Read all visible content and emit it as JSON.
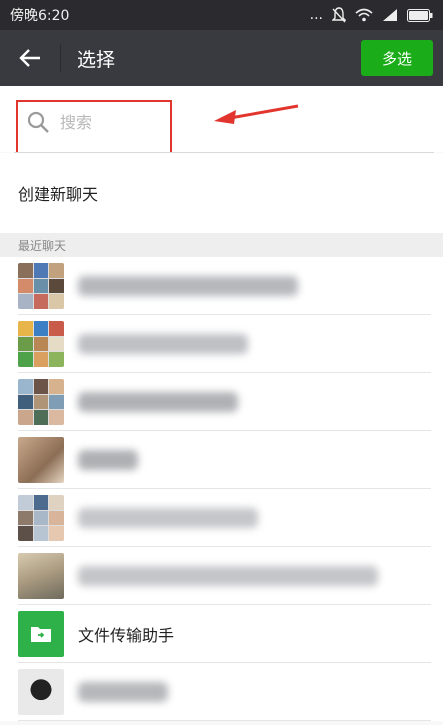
{
  "statusbar": {
    "time": "傍晚6:20",
    "dots": "..."
  },
  "appbar": {
    "back_icon": "arrow-left-icon",
    "title": "选择",
    "multi_select": "多选"
  },
  "search": {
    "placeholder": "搜索",
    "icon": "search-icon"
  },
  "new_chat": {
    "label": "创建新聊天"
  },
  "recent": {
    "header": "最近聊天",
    "items": [
      {
        "type": "group"
      },
      {
        "type": "group"
      },
      {
        "type": "group"
      },
      {
        "type": "single"
      },
      {
        "type": "group"
      },
      {
        "type": "single"
      },
      {
        "type": "file-helper",
        "label": "文件传输助手"
      },
      {
        "type": "single"
      }
    ]
  },
  "colors": {
    "accent_green": "#1aad19",
    "appbar": "#393a3f",
    "annotation_red": "#e1352e"
  }
}
